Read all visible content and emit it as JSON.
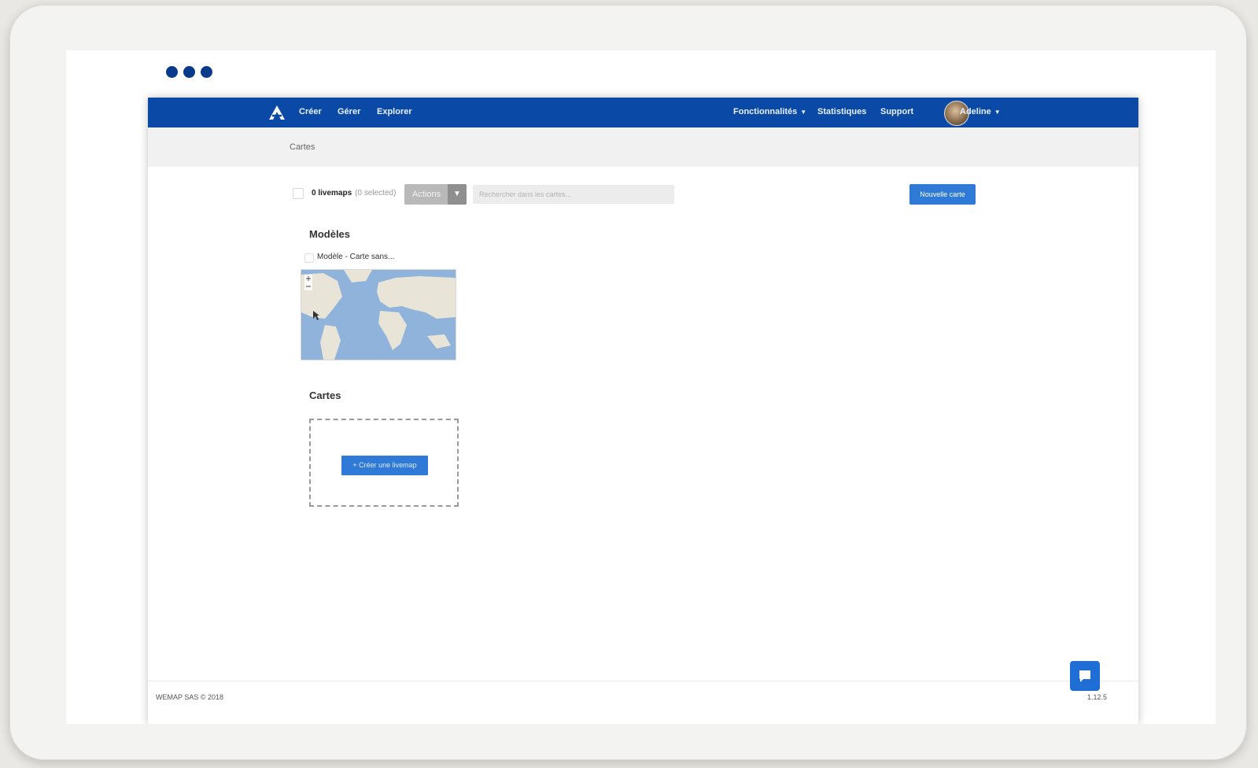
{
  "navbar": {
    "items": [
      "Créer",
      "Gérer",
      "Explorer"
    ],
    "right_items": [
      "Fonctionnalités",
      "Statistiques",
      "Support"
    ],
    "user_name": "Adeline"
  },
  "breadcrumb": "Cartes",
  "toolbar": {
    "count_label": "0 livemaps",
    "selected_label": "(0 selected)",
    "actions_label": "Actions",
    "search_placeholder": "Rechercher dans les cartes...",
    "new_map_label": "Nouvelle carte"
  },
  "templates": {
    "title": "Modèles",
    "item_label": "Modèle - Carte sans..."
  },
  "maps": {
    "title": "Cartes",
    "create_label": "+ Créer une livemap"
  },
  "footer": {
    "copyright": "WEMAP SAS © 2018",
    "version": "1.12.5"
  },
  "colors": {
    "navbar": "#0a4aa6",
    "primary_button": "#2f7ad6",
    "window_dots": "#0a3a8c"
  },
  "icons": [
    "logo-icon",
    "chevron-down-icon",
    "chat-icon",
    "mouse-cursor-icon"
  ]
}
